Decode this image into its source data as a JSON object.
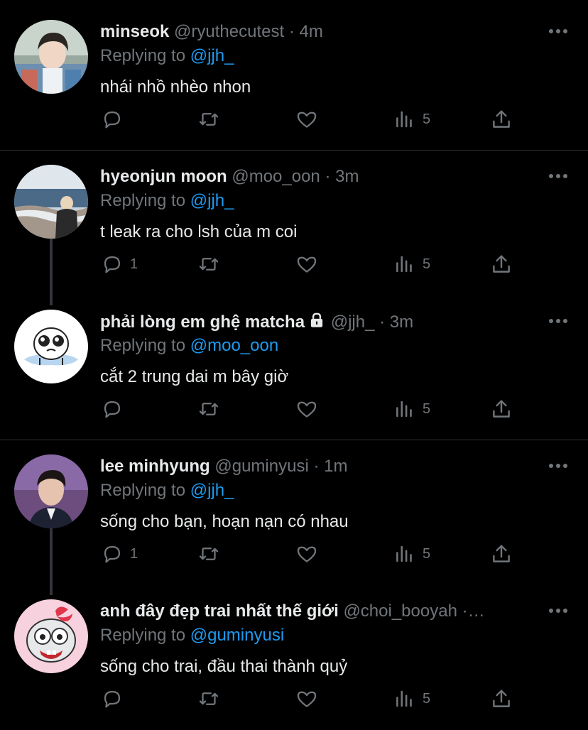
{
  "tweets": [
    {
      "name": "minseok",
      "handle": "@ryuthecutest",
      "dot": "·",
      "time": "4m",
      "replying_prefix": "Replying to",
      "replying_to": "@jjh_",
      "text": "nhái nhồ nhèo nhon",
      "reply_count": "",
      "views": "5",
      "avatar": "avatar-minseok"
    },
    {
      "name": "hyeonjun moon",
      "handle": "@moo_oon",
      "dot": "·",
      "time": "3m",
      "replying_prefix": "Replying to",
      "replying_to": "@jjh_",
      "text": "t leak ra cho lsh của m coi",
      "reply_count": "1",
      "views": "5",
      "avatar": "avatar-hyeonjun"
    },
    {
      "name": "phải lòng em ghệ matcha",
      "handle": "@jjh_",
      "dot": "·",
      "time": "3m",
      "replying_prefix": "Replying to",
      "replying_to": "@moo_oon",
      "text": "cắt 2 trung dai m bây giờ",
      "reply_count": "",
      "views": "5",
      "avatar": "avatar-matcha",
      "locked": true
    },
    {
      "name": "lee minhyung",
      "handle": "@guminyusi",
      "dot": "·",
      "time": "1m",
      "replying_prefix": "Replying to",
      "replying_to": "@jjh_",
      "text": "sống cho bạn, hoạn nạn có nhau",
      "reply_count": "1",
      "views": "5",
      "avatar": "avatar-minhyung"
    },
    {
      "name": "anh đây đẹp trai nhất thế giới",
      "handle": "@choi_booyah",
      "dot": "·…",
      "time": "",
      "replying_prefix": "Replying to",
      "replying_to": "@guminyusi",
      "text": "sống cho trai, đầu thai thành quỷ",
      "reply_count": "",
      "views": "5",
      "avatar": "avatar-choi"
    }
  ],
  "colors": {
    "background": "#000000",
    "text": "#e7e9ea",
    "muted": "#71767b",
    "accent": "#1d9bf0",
    "divider": "#2f3336"
  },
  "icons": [
    "more-icon",
    "reply-icon",
    "retweet-icon",
    "like-icon",
    "views-icon",
    "share-icon",
    "lock-icon"
  ]
}
